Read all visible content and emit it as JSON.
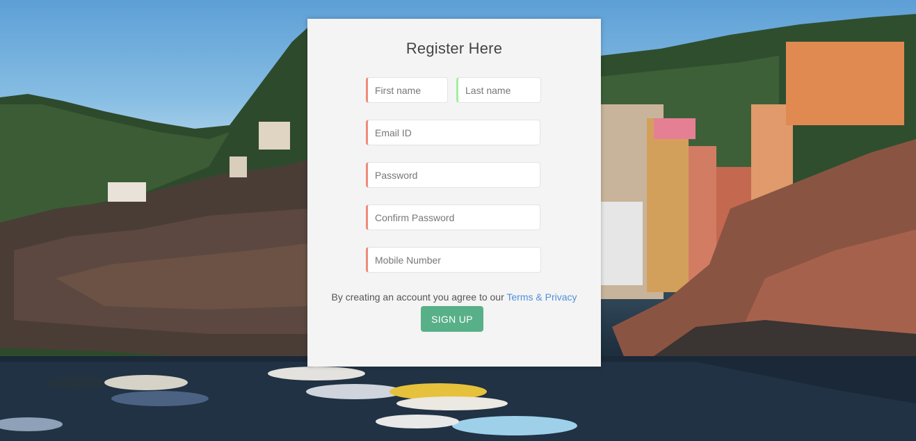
{
  "background": {
    "description_icon": "coastal-village-landscape-photo"
  },
  "form": {
    "title": "Register Here",
    "first_name_placeholder": "First name",
    "last_name_placeholder": "Last name",
    "email_placeholder": "Email ID",
    "password_placeholder": "Password",
    "confirm_password_placeholder": "Confirm Password",
    "mobile_placeholder": "Mobile Number",
    "terms_prefix": "By creating an account you agree to our ",
    "terms_link": "Terms & Privacy",
    "signup_label": "SIGN UP"
  },
  "colors": {
    "card_bg": "#f4f4f4",
    "accent_red": "#ef8b7a",
    "accent_green": "#9ff0a0",
    "button": "#58b088",
    "link": "#4f8fdc"
  }
}
